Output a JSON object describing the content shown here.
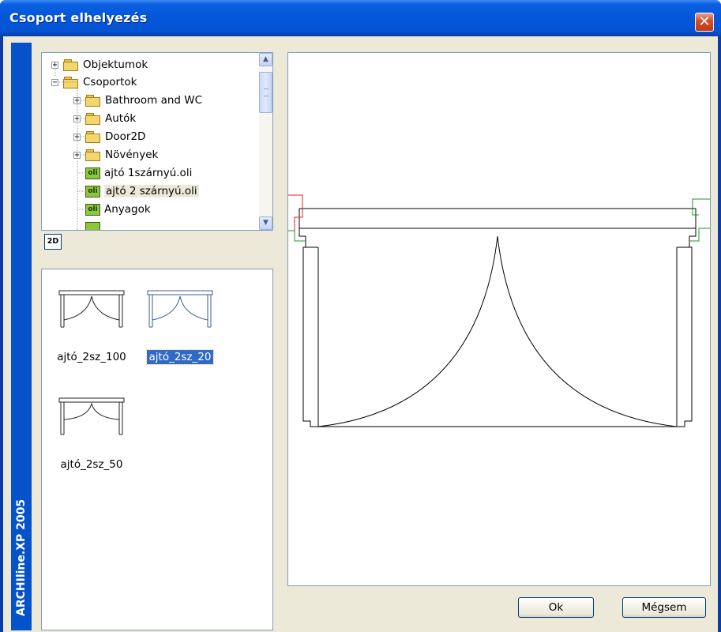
{
  "window": {
    "title": "Csoport elhelyezés",
    "close_icon": "close-icon"
  },
  "brand": {
    "text": "ARCHIline.XP 2005"
  },
  "tree": {
    "items": [
      {
        "label": "Objektumok",
        "icon": "folder-icon",
        "expander": "+"
      },
      {
        "label": "Csoportok",
        "icon": "folder-icon",
        "expander": "−"
      },
      {
        "label": "Bathroom and WC",
        "icon": "folder-icon",
        "expander": "+"
      },
      {
        "label": "Autók",
        "icon": "folder-icon",
        "expander": "+"
      },
      {
        "label": "Door2D",
        "icon": "folder-icon",
        "expander": "+"
      },
      {
        "label": "Növények",
        "icon": "folder-icon",
        "expander": "+"
      },
      {
        "label": "ajtó 1szárnyú.oli",
        "icon": "oli-file-icon",
        "badge": "oli"
      },
      {
        "label": "ajtó 2 szárnyú.oli",
        "icon": "oli-file-icon",
        "badge": "oli",
        "selected": true
      },
      {
        "label": "Anyagok",
        "icon": "oli-file-icon",
        "badge": "oli"
      }
    ]
  },
  "mode_button": {
    "label": "2D"
  },
  "thumbnails": [
    {
      "label": "ajtó_2sz_100",
      "selected": false
    },
    {
      "label": "ajtó_2sz_20",
      "selected": true
    },
    {
      "label": "ajtó_2sz_50",
      "selected": false
    }
  ],
  "buttons": {
    "ok": "Ok",
    "cancel": "Mégsem"
  },
  "colors": {
    "selection": "#316ac5",
    "titlebar": "#0554d8",
    "close": "#d6502d",
    "marker_red": "#e02020",
    "marker_green": "#1a9a2a"
  }
}
